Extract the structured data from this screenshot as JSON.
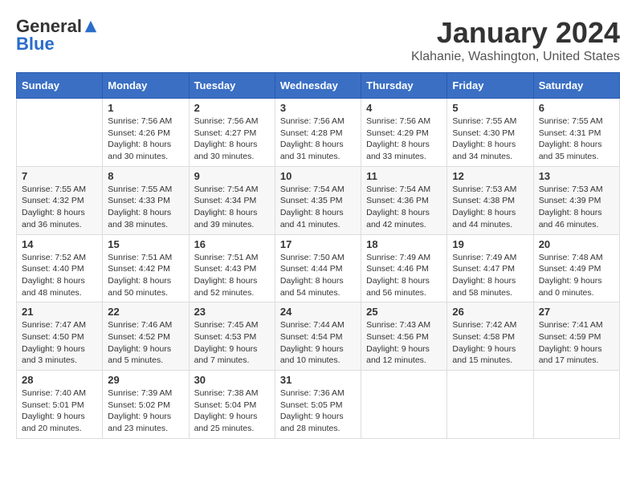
{
  "logo": {
    "general": "General",
    "blue": "Blue"
  },
  "title": "January 2024",
  "location": "Klahanie, Washington, United States",
  "days_of_week": [
    "Sunday",
    "Monday",
    "Tuesday",
    "Wednesday",
    "Thursday",
    "Friday",
    "Saturday"
  ],
  "weeks": [
    [
      {
        "day": null,
        "info": null
      },
      {
        "day": "1",
        "sunrise": "Sunrise: 7:56 AM",
        "sunset": "Sunset: 4:26 PM",
        "daylight": "Daylight: 8 hours and 30 minutes."
      },
      {
        "day": "2",
        "sunrise": "Sunrise: 7:56 AM",
        "sunset": "Sunset: 4:27 PM",
        "daylight": "Daylight: 8 hours and 30 minutes."
      },
      {
        "day": "3",
        "sunrise": "Sunrise: 7:56 AM",
        "sunset": "Sunset: 4:28 PM",
        "daylight": "Daylight: 8 hours and 31 minutes."
      },
      {
        "day": "4",
        "sunrise": "Sunrise: 7:56 AM",
        "sunset": "Sunset: 4:29 PM",
        "daylight": "Daylight: 8 hours and 33 minutes."
      },
      {
        "day": "5",
        "sunrise": "Sunrise: 7:55 AM",
        "sunset": "Sunset: 4:30 PM",
        "daylight": "Daylight: 8 hours and 34 minutes."
      },
      {
        "day": "6",
        "sunrise": "Sunrise: 7:55 AM",
        "sunset": "Sunset: 4:31 PM",
        "daylight": "Daylight: 8 hours and 35 minutes."
      }
    ],
    [
      {
        "day": "7",
        "sunrise": "Sunrise: 7:55 AM",
        "sunset": "Sunset: 4:32 PM",
        "daylight": "Daylight: 8 hours and 36 minutes."
      },
      {
        "day": "8",
        "sunrise": "Sunrise: 7:55 AM",
        "sunset": "Sunset: 4:33 PM",
        "daylight": "Daylight: 8 hours and 38 minutes."
      },
      {
        "day": "9",
        "sunrise": "Sunrise: 7:54 AM",
        "sunset": "Sunset: 4:34 PM",
        "daylight": "Daylight: 8 hours and 39 minutes."
      },
      {
        "day": "10",
        "sunrise": "Sunrise: 7:54 AM",
        "sunset": "Sunset: 4:35 PM",
        "daylight": "Daylight: 8 hours and 41 minutes."
      },
      {
        "day": "11",
        "sunrise": "Sunrise: 7:54 AM",
        "sunset": "Sunset: 4:36 PM",
        "daylight": "Daylight: 8 hours and 42 minutes."
      },
      {
        "day": "12",
        "sunrise": "Sunrise: 7:53 AM",
        "sunset": "Sunset: 4:38 PM",
        "daylight": "Daylight: 8 hours and 44 minutes."
      },
      {
        "day": "13",
        "sunrise": "Sunrise: 7:53 AM",
        "sunset": "Sunset: 4:39 PM",
        "daylight": "Daylight: 8 hours and 46 minutes."
      }
    ],
    [
      {
        "day": "14",
        "sunrise": "Sunrise: 7:52 AM",
        "sunset": "Sunset: 4:40 PM",
        "daylight": "Daylight: 8 hours and 48 minutes."
      },
      {
        "day": "15",
        "sunrise": "Sunrise: 7:51 AM",
        "sunset": "Sunset: 4:42 PM",
        "daylight": "Daylight: 8 hours and 50 minutes."
      },
      {
        "day": "16",
        "sunrise": "Sunrise: 7:51 AM",
        "sunset": "Sunset: 4:43 PM",
        "daylight": "Daylight: 8 hours and 52 minutes."
      },
      {
        "day": "17",
        "sunrise": "Sunrise: 7:50 AM",
        "sunset": "Sunset: 4:44 PM",
        "daylight": "Daylight: 8 hours and 54 minutes."
      },
      {
        "day": "18",
        "sunrise": "Sunrise: 7:49 AM",
        "sunset": "Sunset: 4:46 PM",
        "daylight": "Daylight: 8 hours and 56 minutes."
      },
      {
        "day": "19",
        "sunrise": "Sunrise: 7:49 AM",
        "sunset": "Sunset: 4:47 PM",
        "daylight": "Daylight: 8 hours and 58 minutes."
      },
      {
        "day": "20",
        "sunrise": "Sunrise: 7:48 AM",
        "sunset": "Sunset: 4:49 PM",
        "daylight": "Daylight: 9 hours and 0 minutes."
      }
    ],
    [
      {
        "day": "21",
        "sunrise": "Sunrise: 7:47 AM",
        "sunset": "Sunset: 4:50 PM",
        "daylight": "Daylight: 9 hours and 3 minutes."
      },
      {
        "day": "22",
        "sunrise": "Sunrise: 7:46 AM",
        "sunset": "Sunset: 4:52 PM",
        "daylight": "Daylight: 9 hours and 5 minutes."
      },
      {
        "day": "23",
        "sunrise": "Sunrise: 7:45 AM",
        "sunset": "Sunset: 4:53 PM",
        "daylight": "Daylight: 9 hours and 7 minutes."
      },
      {
        "day": "24",
        "sunrise": "Sunrise: 7:44 AM",
        "sunset": "Sunset: 4:54 PM",
        "daylight": "Daylight: 9 hours and 10 minutes."
      },
      {
        "day": "25",
        "sunrise": "Sunrise: 7:43 AM",
        "sunset": "Sunset: 4:56 PM",
        "daylight": "Daylight: 9 hours and 12 minutes."
      },
      {
        "day": "26",
        "sunrise": "Sunrise: 7:42 AM",
        "sunset": "Sunset: 4:58 PM",
        "daylight": "Daylight: 9 hours and 15 minutes."
      },
      {
        "day": "27",
        "sunrise": "Sunrise: 7:41 AM",
        "sunset": "Sunset: 4:59 PM",
        "daylight": "Daylight: 9 hours and 17 minutes."
      }
    ],
    [
      {
        "day": "28",
        "sunrise": "Sunrise: 7:40 AM",
        "sunset": "Sunset: 5:01 PM",
        "daylight": "Daylight: 9 hours and 20 minutes."
      },
      {
        "day": "29",
        "sunrise": "Sunrise: 7:39 AM",
        "sunset": "Sunset: 5:02 PM",
        "daylight": "Daylight: 9 hours and 23 minutes."
      },
      {
        "day": "30",
        "sunrise": "Sunrise: 7:38 AM",
        "sunset": "Sunset: 5:04 PM",
        "daylight": "Daylight: 9 hours and 25 minutes."
      },
      {
        "day": "31",
        "sunrise": "Sunrise: 7:36 AM",
        "sunset": "Sunset: 5:05 PM",
        "daylight": "Daylight: 9 hours and 28 minutes."
      },
      {
        "day": null,
        "info": null
      },
      {
        "day": null,
        "info": null
      },
      {
        "day": null,
        "info": null
      }
    ]
  ]
}
